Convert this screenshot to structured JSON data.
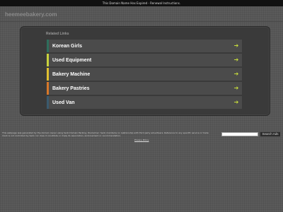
{
  "top_bar": {
    "text": "This Domain Name Has Expired - Renewal Instructions."
  },
  "header": {
    "domain": "heemeebakery.com"
  },
  "related": {
    "heading": "Related Links",
    "links": [
      {
        "label": "Korean Girls",
        "color": "#2e6e5c"
      },
      {
        "label": "Used Equipment",
        "color": "#c8d23c"
      },
      {
        "label": "Bakery Machine",
        "color": "#e0c030"
      },
      {
        "label": "Bakery Pastries",
        "color": "#d8782a"
      },
      {
        "label": "Used Van",
        "color": "#3a5a6e"
      }
    ],
    "arrow_icon": "arrow-right-icon",
    "arrow_color": "#c8de3c",
    "arrow_glyph": "➔"
  },
  "footer": {
    "disclaimer": "This webpage was generated by the domain owner using Sedo Domain Parking. Disclaimer: Sedo maintains no relationship with third party advertisers. Reference to any specific service or trade mark is not controlled by Sedo nor does it constitute or imply its association, endorsement or recommendation.",
    "search_placeholder": "",
    "search_button": "Search Ads",
    "privacy": "Privacy Policy"
  }
}
